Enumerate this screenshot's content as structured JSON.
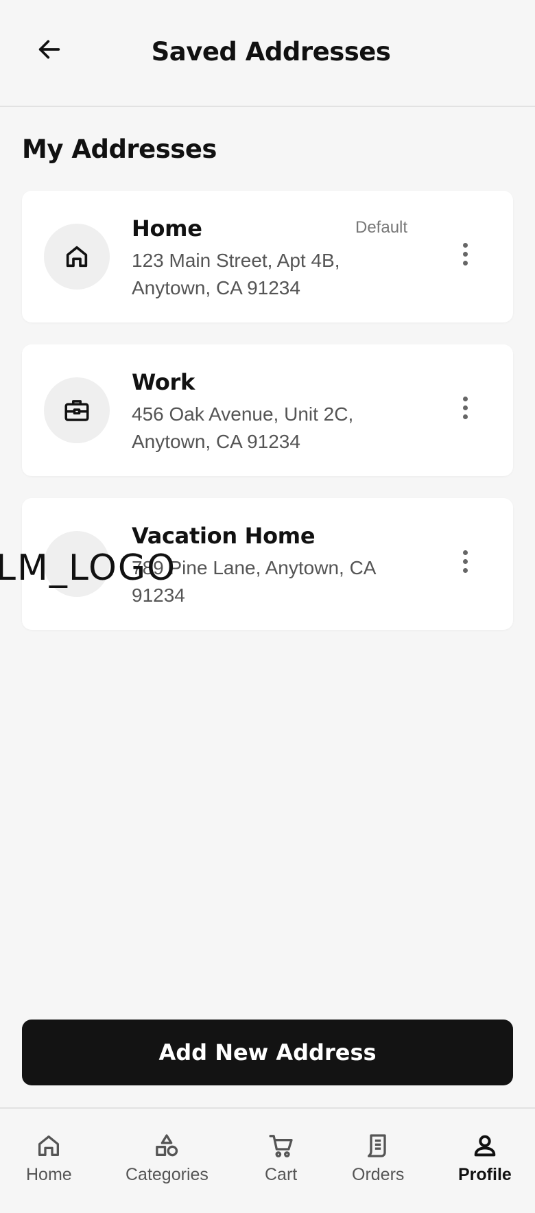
{
  "header": {
    "title": "Saved Addresses",
    "back_icon": "arrow-left-icon"
  },
  "section_title": "My Addresses",
  "addresses": [
    {
      "name": "Home",
      "address": "123 Main Street, Apt 4B, Anytown, CA 91234",
      "badge": "Default",
      "icon": "house-icon"
    },
    {
      "name": "Work",
      "address": "456 Oak Avenue, Unit 2C, Anytown, CA 91234",
      "icon": "briefcase-icon"
    },
    {
      "name": "Vacation Home",
      "address": "789 Pine Lane, Anytown, CA 91234",
      "icon": "vacation-icon"
    }
  ],
  "watermark": "LM_LOGO",
  "add_button_label": "Add New Address",
  "bottom_nav": {
    "items": [
      {
        "label": "Home",
        "icon": "home-icon",
        "active": false
      },
      {
        "label": "Categories",
        "icon": "categories-icon",
        "active": false
      },
      {
        "label": "Cart",
        "icon": "cart-icon",
        "active": false
      },
      {
        "label": "Orders",
        "icon": "orders-icon",
        "active": false
      },
      {
        "label": "Profile",
        "icon": "profile-icon",
        "active": true
      }
    ]
  },
  "colors": {
    "background": "#f6f6f6",
    "card": "#ffffff",
    "primary_button": "#131313",
    "icon_circle": "#efefef"
  }
}
